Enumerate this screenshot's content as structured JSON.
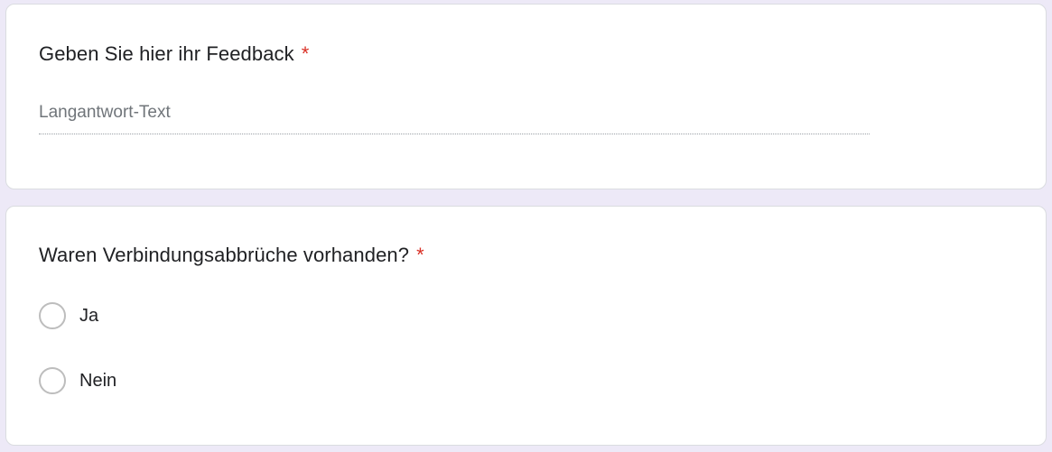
{
  "questions": [
    {
      "title": "Geben Sie hier ihr Feedback",
      "required_mark": "*",
      "answer_placeholder": "Langantwort-Text"
    },
    {
      "title": "Waren Verbindungsabbrüche vorhanden?",
      "required_mark": "*",
      "options": [
        {
          "label": "Ja"
        },
        {
          "label": "Nein"
        }
      ]
    }
  ],
  "colors": {
    "page_background": "#ede9f7",
    "card_background": "#ffffff",
    "required": "#d93025",
    "radio_border": "#bdbdbd",
    "placeholder_text": "#70757a"
  }
}
